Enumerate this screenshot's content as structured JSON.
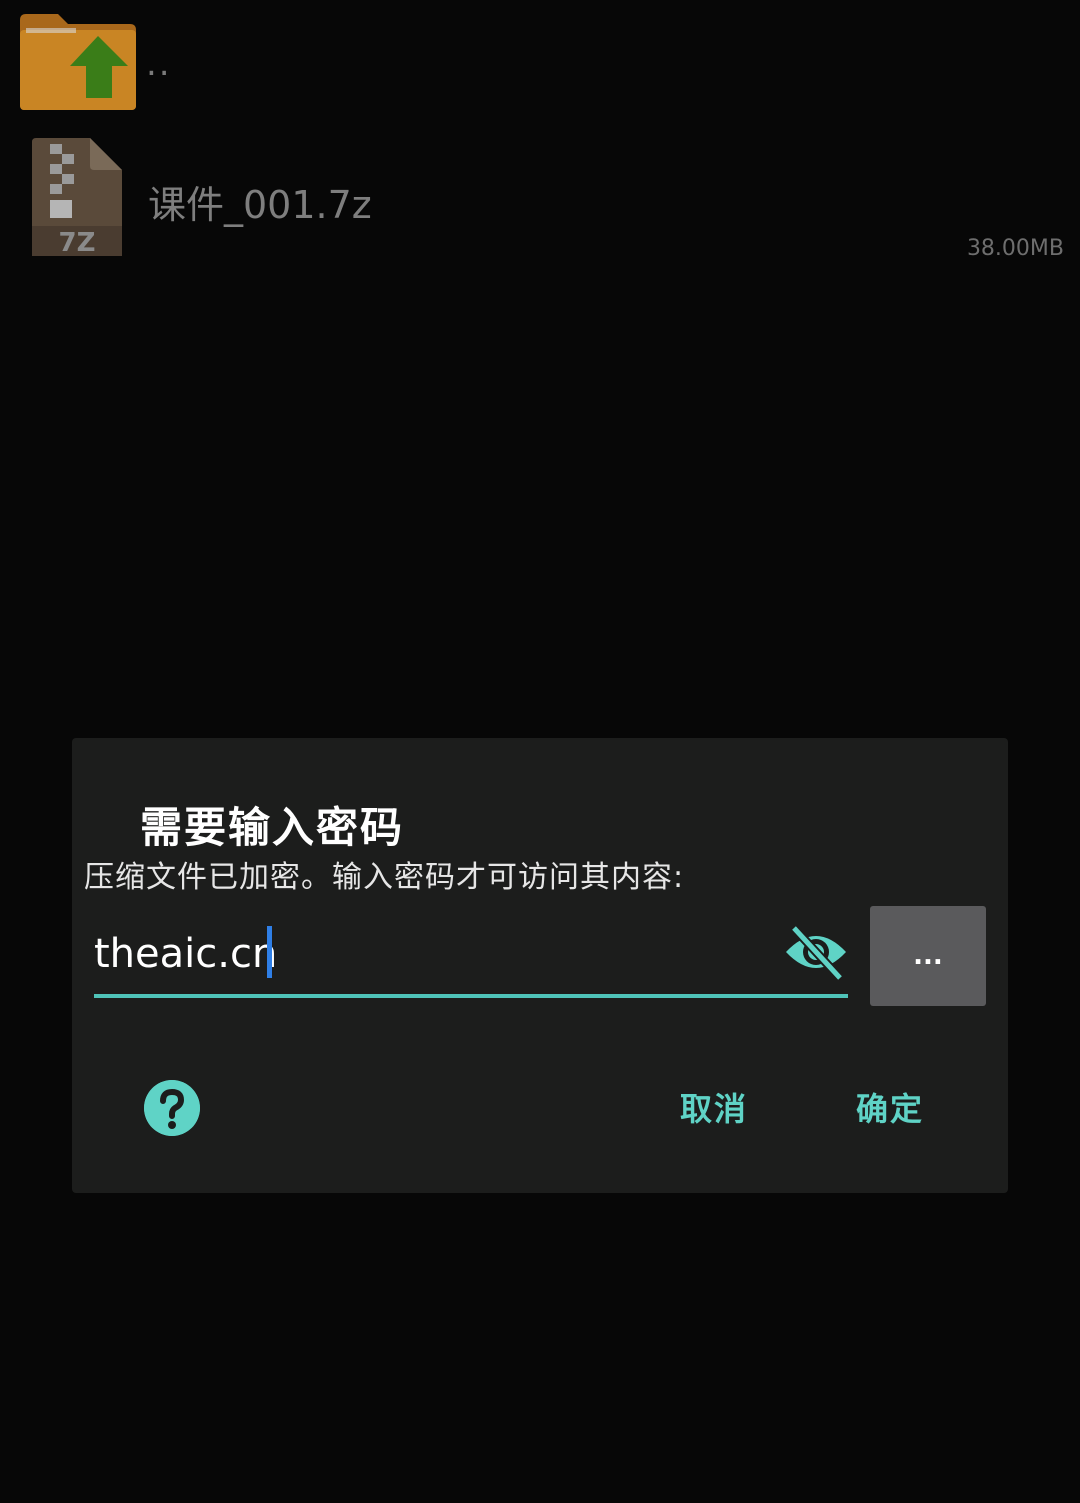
{
  "file_list": {
    "parent_row": {
      "label": "..",
      "icon": "folder-up-icon"
    },
    "files": [
      {
        "name": "课件_001.7z",
        "size": "38.00MB",
        "icon": "archive-7z-icon",
        "icon_text": "7Z"
      }
    ]
  },
  "dialog": {
    "title": "需要输入密码",
    "message": "压缩文件已加密。输入密码才可访问其内容:",
    "password_value": "theaic.cn",
    "visibility_icon": "eye-off-icon",
    "more_label": "...",
    "help_icon": "help-icon",
    "cancel_label": "取消",
    "ok_label": "确定"
  },
  "colors": {
    "accent": "#5fd3c6",
    "background": "#070707",
    "dialog_bg": "#1c1d1c",
    "caret": "#2f7fe6",
    "more_button_bg": "#5a5a5c",
    "folder": "#c98524",
    "arrow": "#3a7d18"
  }
}
